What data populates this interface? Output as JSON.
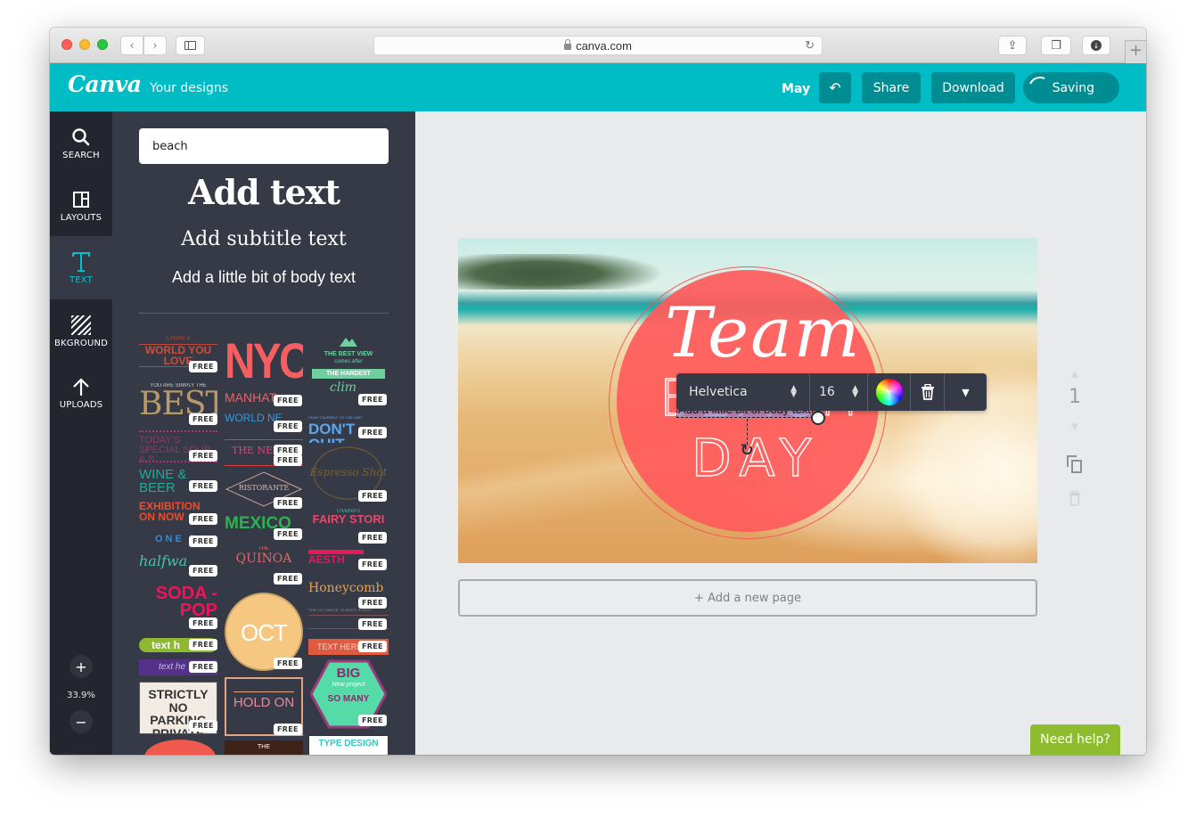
{
  "browser": {
    "url": "canva.com",
    "buttons": {
      "back": "back-icon",
      "forward": "forward-icon",
      "sidebar": "sidebar-icon",
      "share": "share-icon",
      "tabs": "tabs-icon",
      "downloads": "download-icon",
      "new_tab": "+"
    }
  },
  "header": {
    "logo": "Canva",
    "your_designs": "Your designs",
    "user": "May",
    "undo_icon": "↶",
    "share_label": "Share",
    "download_label": "Download",
    "saving_label": "Saving",
    "brand_color": "#00bcc5",
    "button_color": "#008c93"
  },
  "rail": {
    "items": [
      {
        "label": "SEARCH",
        "icon": "search-icon"
      },
      {
        "label": "LAYOUTS",
        "icon": "layouts-icon"
      },
      {
        "label": "TEXT",
        "icon": "text-icon",
        "active": true
      },
      {
        "label": "BKGROUND",
        "icon": "background-icon"
      },
      {
        "label": "UPLOADS",
        "icon": "upload-icon"
      }
    ],
    "zoom_in": "+",
    "zoom_level": "33.9%",
    "zoom_out": "−"
  },
  "panel": {
    "search_value": "beach",
    "add_heading": "Add text",
    "add_subtitle": "Add subtitle text",
    "add_body": "Add a little bit of body text",
    "free_label": "FREE",
    "templates": [
      {
        "text": "WORLD YOU LOVE"
      },
      {
        "text": "BEST"
      },
      {
        "text": "TODAY'S SPECIAL SOUP & S"
      },
      {
        "text": "WINE & BEER"
      },
      {
        "text": "EXHIBITION ON NOW"
      },
      {
        "text": "ONE D"
      },
      {
        "text": "halfwa"
      },
      {
        "text": "SODA -POP"
      },
      {
        "text": "text h"
      },
      {
        "text": "text he"
      },
      {
        "text": "STRICTLY NO PARKING PRIVATE PRO"
      },
      {
        "text": "NYC"
      },
      {
        "text": "MANHAT"
      },
      {
        "text": "WORLD NE"
      },
      {
        "text": "THE NEW"
      },
      {
        "text": "RISTORANTE"
      },
      {
        "text": "MEXICO"
      },
      {
        "text": "QUINOA"
      },
      {
        "text": "OCT"
      },
      {
        "text": "HOLD ON"
      },
      {
        "text": "THE BEST VIEW"
      },
      {
        "text": "THE HARDEST"
      },
      {
        "text": "DON'T QUIT"
      },
      {
        "text": "Espresso Shot"
      },
      {
        "text": "FAIRY STORI"
      },
      {
        "text": "AESTH"
      },
      {
        "text": "Honeycomb"
      },
      {
        "text": "TEXT HERE"
      },
      {
        "text": "BIG"
      },
      {
        "text": "SO MANY"
      },
      {
        "text": "TYPE DESIGN"
      }
    ]
  },
  "canvas": {
    "script_text": "Team",
    "beach_text": "BEACH",
    "day_text": "DAY",
    "selected_text": "Add a little bit of body text",
    "badge_color": "#ff5b5b"
  },
  "toolbar": {
    "font": "Helvetica",
    "size": "16",
    "color_icon": "color-picker-icon",
    "delete_icon": "trash-icon",
    "more_icon": "▼"
  },
  "workspace": {
    "page_number": "1",
    "add_page": "+ Add a new page",
    "help": "Need help?"
  }
}
